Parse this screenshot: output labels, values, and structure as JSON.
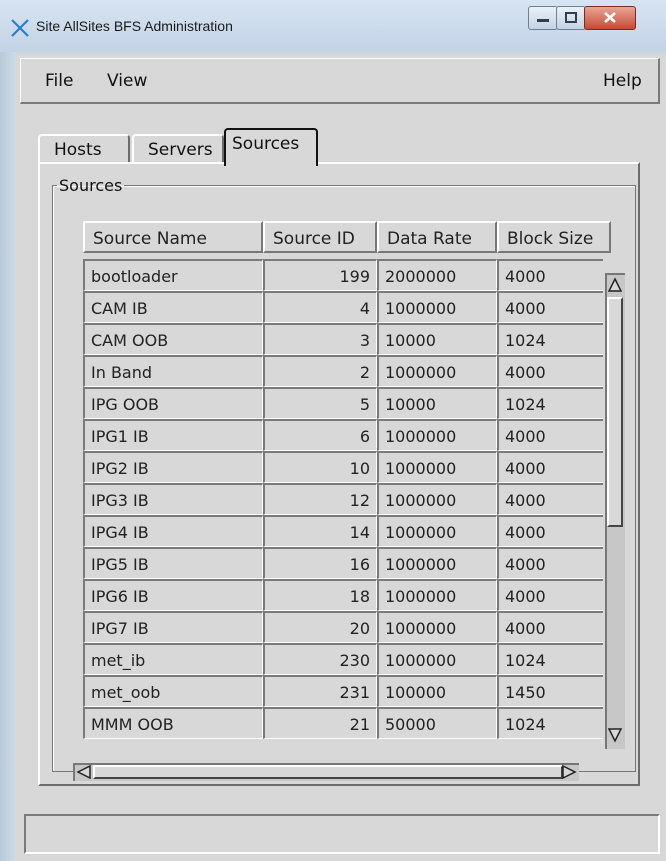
{
  "window": {
    "title": "Site AllSites BFS Administration"
  },
  "menubar": {
    "file": "File",
    "view": "View",
    "help": "Help"
  },
  "tabs": [
    {
      "label": "Hosts",
      "active": false
    },
    {
      "label": "Servers",
      "active": false
    },
    {
      "label": "Sources",
      "active": true
    }
  ],
  "sources_group": {
    "legend": "Sources",
    "columns": [
      "Source Name",
      "Source ID",
      "Data Rate",
      "Block Size"
    ],
    "rows": [
      [
        "bootloader",
        "199",
        "2000000",
        "4000"
      ],
      [
        "CAM IB",
        "4",
        "1000000",
        "4000"
      ],
      [
        "CAM OOB",
        "3",
        "10000",
        "1024"
      ],
      [
        "In Band",
        "2",
        "1000000",
        "4000"
      ],
      [
        "IPG OOB",
        "5",
        "10000",
        "1024"
      ],
      [
        "IPG1 IB",
        "6",
        "1000000",
        "4000"
      ],
      [
        "IPG2 IB",
        "10",
        "1000000",
        "4000"
      ],
      [
        "IPG3 IB",
        "12",
        "1000000",
        "4000"
      ],
      [
        "IPG4 IB",
        "14",
        "1000000",
        "4000"
      ],
      [
        "IPG5 IB",
        "16",
        "1000000",
        "4000"
      ],
      [
        "IPG6 IB",
        "18",
        "1000000",
        "4000"
      ],
      [
        "IPG7 IB",
        "20",
        "1000000",
        "4000"
      ],
      [
        "met_ib",
        "230",
        "1000000",
        "1024"
      ],
      [
        "met_oob",
        "231",
        "100000",
        "1450"
      ],
      [
        "MMM OOB",
        "21",
        "50000",
        "1024"
      ]
    ]
  },
  "icons": {
    "app": "x-app-icon",
    "minimize": "minimize-icon",
    "maximize": "maximize-icon",
    "close": "close-icon"
  },
  "colors": {
    "titlebar": "#c3d3e6",
    "close_button": "#c44b35",
    "panel": "#d8d8d8"
  }
}
